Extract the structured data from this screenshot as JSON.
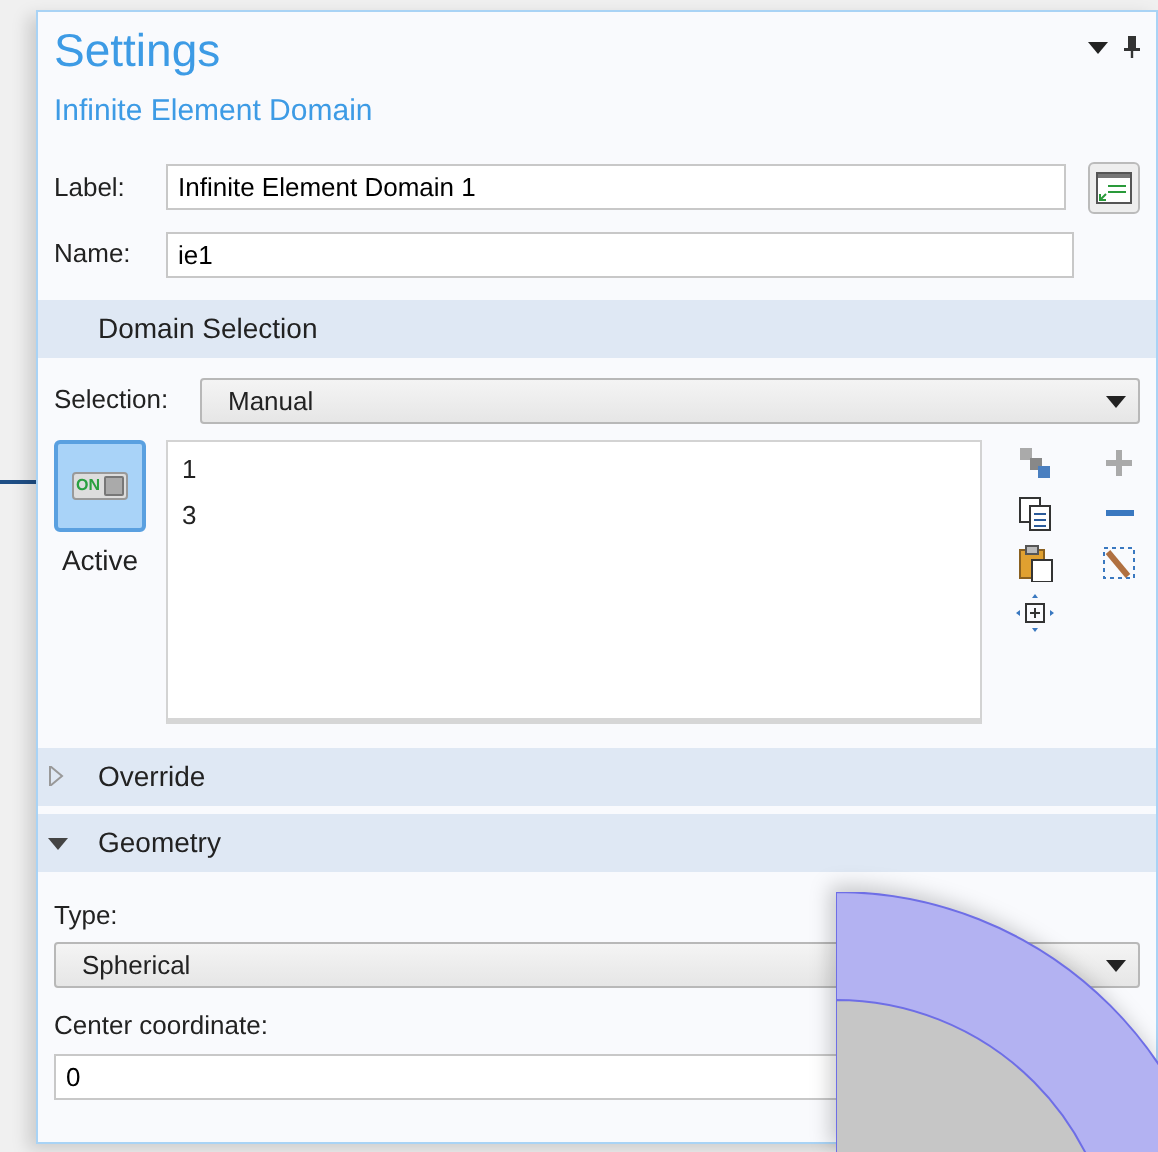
{
  "panel": {
    "title": "Settings",
    "subtitle": "Infinite Element Domain"
  },
  "fields": [
    {
      "label": "Label:",
      "value": "Infinite Element Domain 1"
    },
    {
      "label": "Name:",
      "value": "ie1"
    }
  ],
  "domain_selection": {
    "header": "Domain Selection",
    "selection_label": "Selection:",
    "selection_value": "Manual",
    "active": {
      "label": "Active",
      "toggle_text": "ON",
      "on": true
    },
    "items": [
      "1",
      "3"
    ]
  },
  "sections": [
    {
      "header": "Override",
      "expanded": false
    },
    {
      "header": "Geometry",
      "expanded": true
    }
  ],
  "geometry": {
    "type_label": "Type:",
    "type_value": "Spherical",
    "center_label": "Center coordinate:",
    "center_value": "0"
  }
}
